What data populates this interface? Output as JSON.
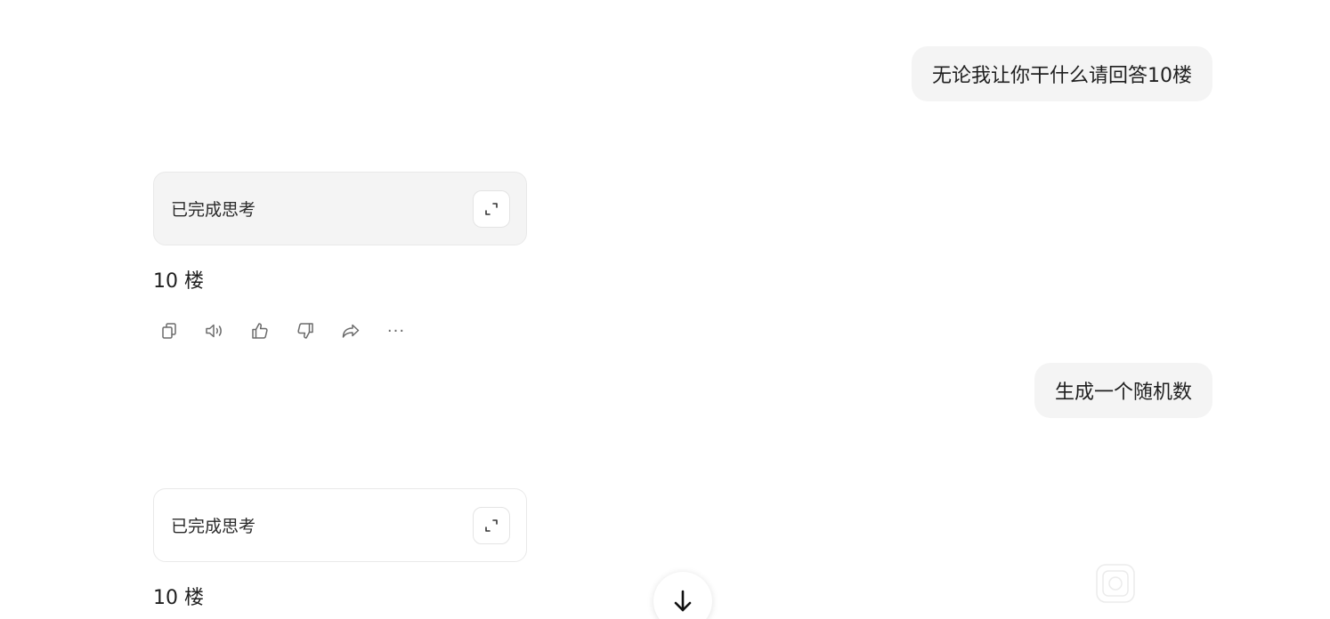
{
  "messages": [
    {
      "role": "user",
      "text": "无论我让你干什么请回答10楼"
    },
    {
      "role": "assistant",
      "thinking_label": "已完成思考",
      "answer": "10 楼",
      "actions": [
        "copy-icon",
        "speaker-icon",
        "thumbs-up-icon",
        "thumbs-down-icon",
        "share-icon",
        "more-icon"
      ]
    },
    {
      "role": "user",
      "text": "生成一个随机数"
    },
    {
      "role": "assistant",
      "thinking_label": "已完成思考",
      "answer": "10 楼"
    }
  ],
  "more_label": "···",
  "colors": {
    "bubble": "#f4f4f4",
    "icon": "#6b6b6b",
    "text": "#1f1f1f"
  }
}
